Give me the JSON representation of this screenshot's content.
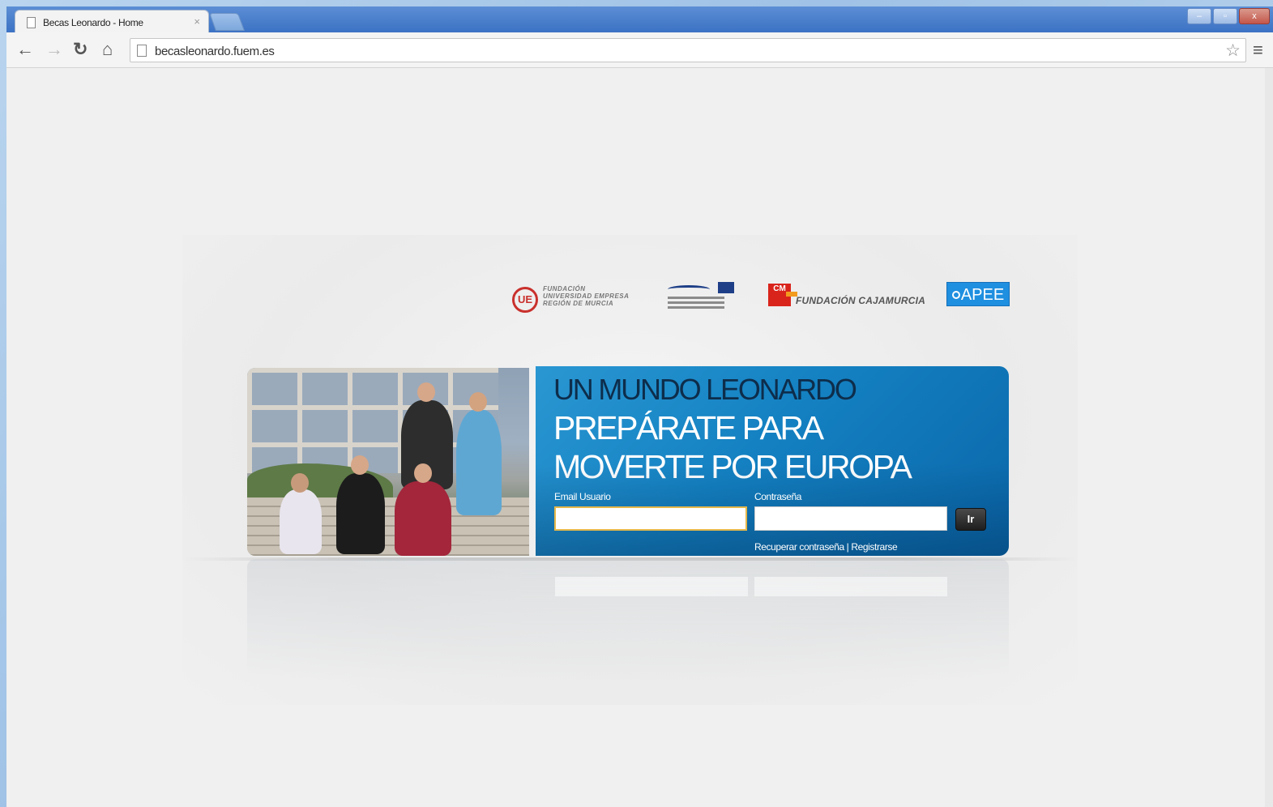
{
  "browser": {
    "tab_title": "Becas Leonardo - Home",
    "tab_close": "×",
    "url": "becasleonardo.fuem.es",
    "controls": {
      "minimize": "–",
      "maximize": "▫",
      "close": "x"
    }
  },
  "logos": {
    "fue_lines": [
      "FUNDACIÓN",
      "UNIVERSIDAD EMPRESA",
      "REGIÓN DE MURCIA"
    ],
    "cajamurcia_badge": "CM",
    "cajamurcia_text": "FUNDACIÓN CAJAMURCIA",
    "apee_text": "APEE"
  },
  "banner": {
    "headline_top": "UN MUNDO LEONARDO",
    "headline_line2": "PREPÁRATE PARA",
    "headline_line3": "MOVERTE POR EUROPA"
  },
  "login": {
    "email_label": "Email Usuario",
    "email_value": "",
    "password_label": "Contraseña",
    "password_value": "",
    "submit_label": "Ir",
    "recover_link": "Recuperar contraseña",
    "separator": " | ",
    "register_link": "Registrarse"
  },
  "colors": {
    "panel_blue": "#1481c2",
    "headline_dark": "#0d2d4b",
    "titlebar_blue": "#3c72c4"
  }
}
